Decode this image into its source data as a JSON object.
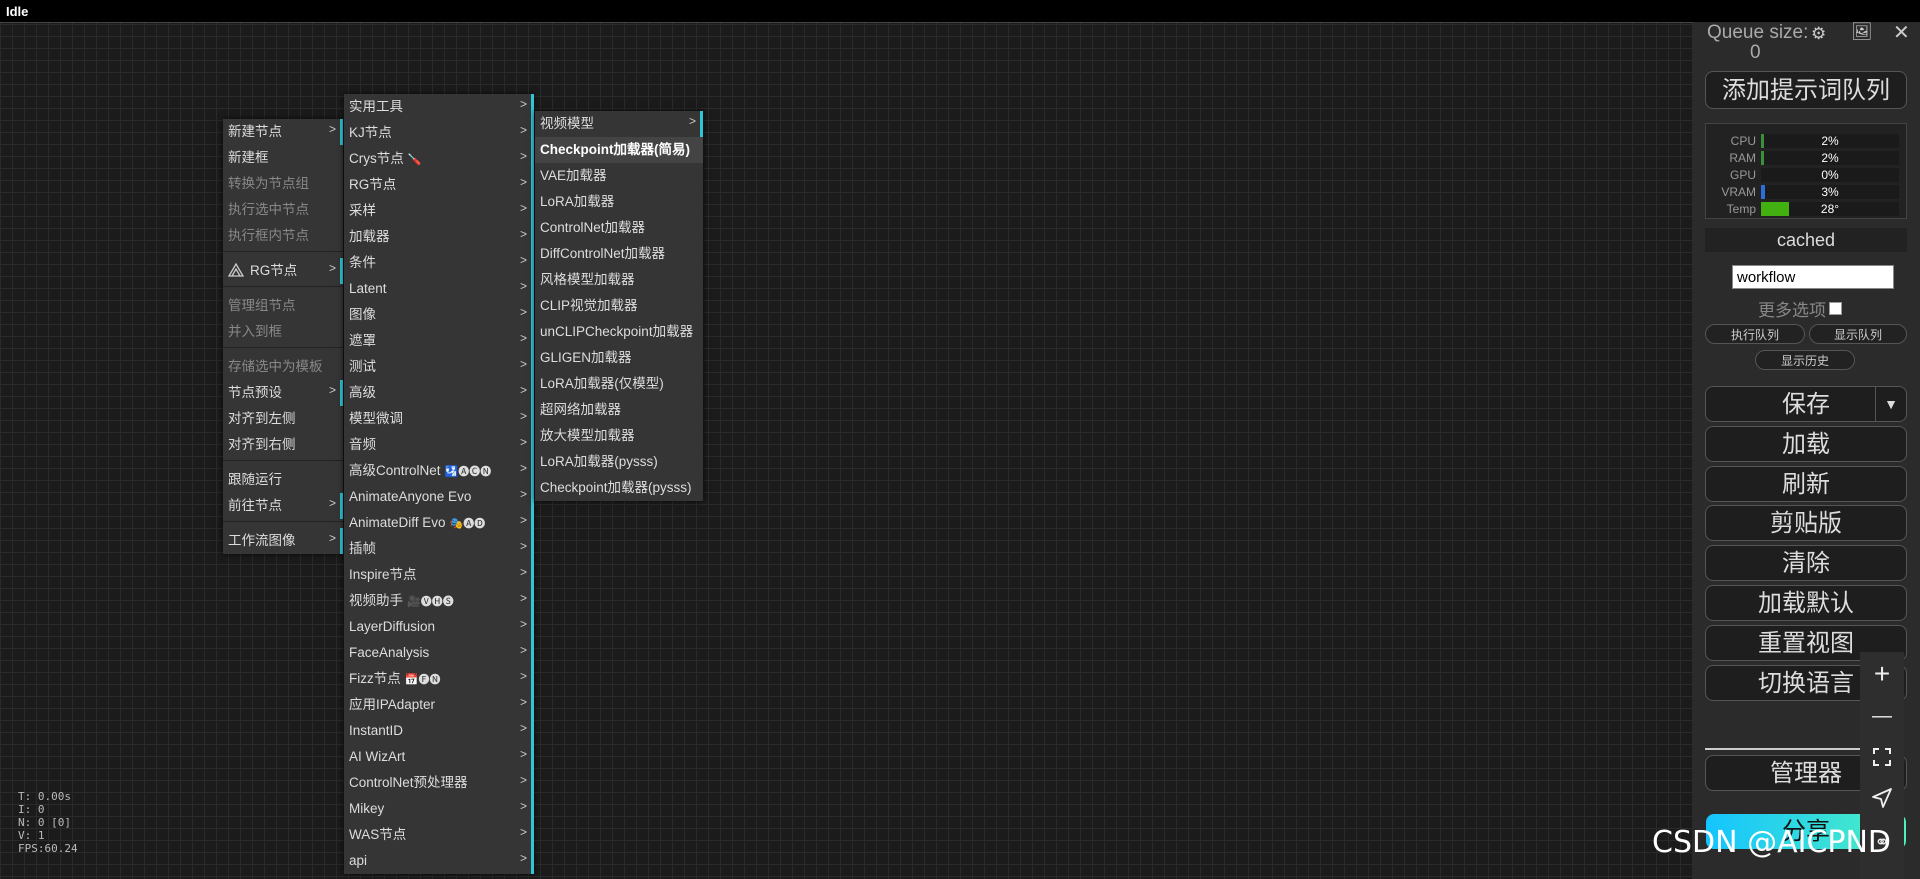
{
  "topbar": {
    "title": "Idle"
  },
  "menu1": {
    "items": [
      {
        "label": "新建节点",
        "state": "sub"
      },
      {
        "label": "新建框",
        "state": "normal"
      },
      {
        "label": "转换为节点组",
        "state": "disabled"
      },
      {
        "label": "执行选中节点",
        "state": "disabled"
      },
      {
        "label": "执行框内节点",
        "state": "disabled"
      },
      {
        "label": "RG节点",
        "state": "sub"
      },
      {
        "label": "管理组节点",
        "state": "disabled"
      },
      {
        "label": "并入到框",
        "state": "disabled"
      },
      {
        "label": "存储选中为模板",
        "state": "disabled"
      },
      {
        "label": "节点预设",
        "state": "sub"
      },
      {
        "label": "对齐到左侧",
        "state": "normal"
      },
      {
        "label": "对齐到右侧",
        "state": "normal"
      },
      {
        "label": "跟随运行",
        "state": "normal"
      },
      {
        "label": "前往节点",
        "state": "sub"
      },
      {
        "label": "工作流图像",
        "state": "sub"
      }
    ]
  },
  "menu2": {
    "items": [
      {
        "label": "实用工具"
      },
      {
        "label": "KJ节点"
      },
      {
        "label": "Crys节点"
      },
      {
        "label": "RG节点"
      },
      {
        "label": "采样"
      },
      {
        "label": "加载器"
      },
      {
        "label": "条件"
      },
      {
        "label": "Latent"
      },
      {
        "label": "图像"
      },
      {
        "label": "遮罩"
      },
      {
        "label": "测试"
      },
      {
        "label": "高级"
      },
      {
        "label": "模型微调"
      },
      {
        "label": "音频"
      },
      {
        "label": "高级ControlNet"
      },
      {
        "label": "AnimateAnyone Evo"
      },
      {
        "label": "AnimateDiff Evo"
      },
      {
        "label": "插帧"
      },
      {
        "label": "Inspire节点"
      },
      {
        "label": "视频助手"
      },
      {
        "label": "LayerDiffusion"
      },
      {
        "label": "FaceAnalysis"
      },
      {
        "label": "Fizz节点"
      },
      {
        "label": "应用IPAdapter"
      },
      {
        "label": "InstantID"
      },
      {
        "label": "AI WizArt"
      },
      {
        "label": "ControlNet预处理器"
      },
      {
        "label": "Mikey"
      },
      {
        "label": "WAS节点"
      },
      {
        "label": "api"
      }
    ],
    "emojis": {
      "Crys节点": "🪛",
      "高级ControlNet": "🛂🅐🅒🅝",
      "AnimateDiff Evo": "🎭🅐🅓",
      "视频助手": "🎥🅥🅗🅢",
      "Fizz节点": "📅🅕🅝"
    }
  },
  "menu3": {
    "items": [
      {
        "label": "视频模型",
        "sub": true
      },
      {
        "label": "Checkpoint加载器(简易)",
        "highlight": true
      },
      {
        "label": "VAE加载器"
      },
      {
        "label": "LoRA加载器"
      },
      {
        "label": "ControlNet加载器"
      },
      {
        "label": "DiffControlNet加载器"
      },
      {
        "label": "风格模型加载器"
      },
      {
        "label": "CLIP视觉加载器"
      },
      {
        "label": "unCLIPCheckpoint加载器"
      },
      {
        "label": "GLIGEN加载器"
      },
      {
        "label": "LoRA加载器(仅模型)"
      },
      {
        "label": "超网络加载器"
      },
      {
        "label": "放大模型加载器"
      },
      {
        "label": "LoRA加载器(pysss)"
      },
      {
        "label": "Checkpoint加载器(pysss)"
      }
    ]
  },
  "panel": {
    "queue_label": "Queue size:",
    "queue_value": "0",
    "add_prompt": "添加提示词队列",
    "stats": [
      {
        "label": "CPU",
        "value": "2%",
        "fill": 0.02,
        "color": "#3a8f3a"
      },
      {
        "label": "RAM",
        "value": "2%",
        "fill": 0.02,
        "color": "#3a8f3a"
      },
      {
        "label": "GPU",
        "value": "0%",
        "fill": 0.0,
        "color": "#3a8f3a"
      },
      {
        "label": "VRAM",
        "value": "3%",
        "fill": 0.03,
        "color": "#2d6fd8"
      },
      {
        "label": "Temp",
        "value": "28°",
        "fill": 0.2,
        "color": "#43b012"
      }
    ],
    "cached": "cached",
    "workflow_value": "workflow",
    "more_options": "更多选项",
    "exec_queue": "执行队列",
    "show_queue": "显示队列",
    "show_history": "显示历史",
    "save": "保存",
    "load": "加载",
    "refresh": "刷新",
    "clipspace": "剪贴版",
    "clear": "清除",
    "load_default": "加载默认",
    "reset_view": "重置视图",
    "switch_lang": "切换语言",
    "manager": "管理器",
    "share": "分享"
  },
  "zoom": {
    "plus": "+",
    "minus": "—"
  },
  "perf": {
    "t": "T: 0.00s",
    "i": "I: 0",
    "n": "N: 0 [0]",
    "v": "V: 1",
    "fps": "FPS:60.24"
  },
  "watermark": "CSDN @AICPND"
}
